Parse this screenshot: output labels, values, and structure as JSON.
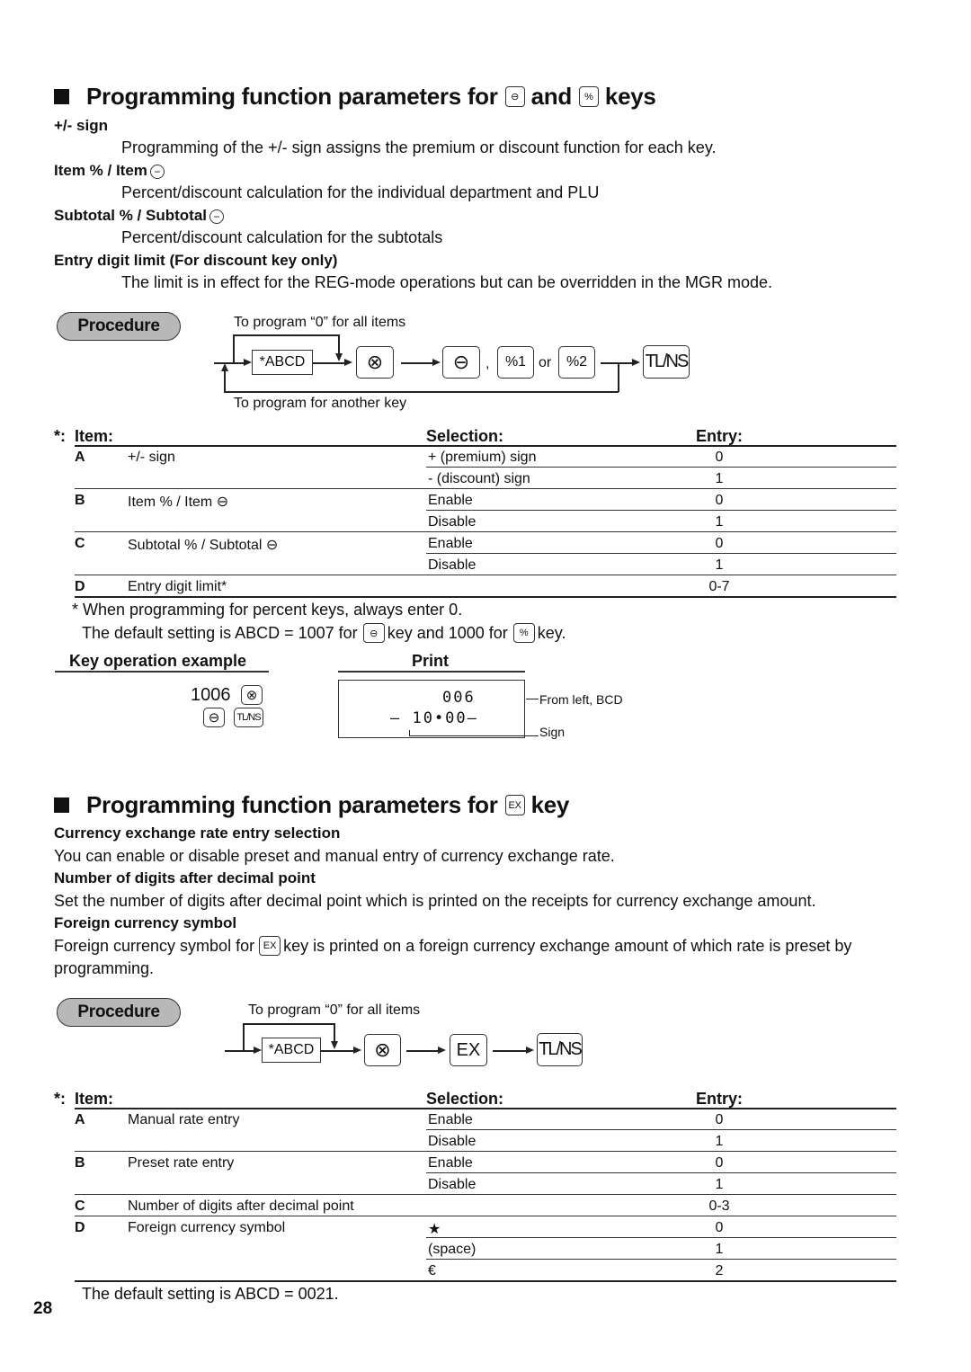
{
  "section1": {
    "heading_pre": "Programming function parameters for",
    "heading_key1": "⊖",
    "heading_mid": "and",
    "heading_key2": "%",
    "heading_post": "keys",
    "params": [
      {
        "title": "+/- sign",
        "desc": "Programming of the +/- sign assigns the premium or discount function for each key."
      },
      {
        "title": "Item % / Item",
        "desc": "Percent/discount calculation for the individual department and PLU"
      },
      {
        "title": "Subtotal % / Subtotal",
        "desc": "Percent/discount calculation for the subtotals"
      },
      {
        "title": "Entry digit limit (For discount key only)",
        "desc": "The limit is in effect for the REG-mode operations but can be overridden in the MGR mode."
      }
    ],
    "procedure": {
      "label": "Procedure",
      "loop_top": "To program “0” for all items",
      "loop_bottom": "To program for another key",
      "abcd": "*ABCD",
      "keys": {
        "multiply": "⊗",
        "minus": "⊖",
        "pct1": "%1",
        "or": "or",
        "pct2": "%2",
        "comma": ",",
        "tlns": "TL/NS"
      }
    },
    "table": {
      "star": "*:",
      "headers": {
        "item": "Item:",
        "selection": "Selection:",
        "entry": "Entry:"
      },
      "rows": [
        {
          "letter": "A",
          "item": "+/- sign",
          "selection": "+ (premium) sign",
          "entry": "0"
        },
        {
          "letter": "",
          "item": "",
          "selection": "- (discount) sign",
          "entry": "1"
        },
        {
          "letter": "B",
          "item": "Item % / Item ⊖",
          "selection": "Enable",
          "entry": "0"
        },
        {
          "letter": "",
          "item": "",
          "selection": "Disable",
          "entry": "1"
        },
        {
          "letter": "C",
          "item": "Subtotal % / Subtotal ⊖",
          "selection": "Enable",
          "entry": "0"
        },
        {
          "letter": "",
          "item": "",
          "selection": "Disable",
          "entry": "1"
        },
        {
          "letter": "D",
          "item": "Entry digit limit*",
          "selection": "",
          "entry": "0-7"
        }
      ]
    },
    "footnote": "* When programming for percent keys, always enter 0.",
    "default_pre": "The default setting is ABCD = 1007 for",
    "default_mid": "key and 1000 for",
    "default_post": "key.",
    "example": {
      "key_op_title": "Key operation example",
      "print_title": "Print",
      "entry_number": "1006",
      "print_line1": "006",
      "print_line2": "–  10•00–",
      "label_bcd": "From left, BCD",
      "label_sign": "Sign"
    }
  },
  "section2": {
    "heading_pre": "Programming function parameters for",
    "heading_key": "EX",
    "heading_post": "key",
    "params": [
      {
        "title": "Currency exchange rate entry selection",
        "desc": "You can enable or disable preset and manual entry of currency exchange rate."
      },
      {
        "title": "Number of digits after decimal point",
        "desc": "Set the number of digits after decimal point which is printed on the receipts for currency exchange amount."
      },
      {
        "title": "Foreign currency symbol",
        "desc_pre": "Foreign currency symbol for",
        "desc_post": "key is printed on a foreign currency exchange amount of which rate is preset by",
        "desc_line2": "programming."
      }
    ],
    "procedure": {
      "label": "Procedure",
      "loop_top": "To program “0” for all items",
      "abcd": "*ABCD",
      "keys": {
        "multiply": "⊗",
        "ex": "EX",
        "tlns": "TL/NS"
      }
    },
    "table": {
      "star": "*:",
      "headers": {
        "item": "Item:",
        "selection": "Selection:",
        "entry": "Entry:"
      },
      "rows": [
        {
          "letter": "A",
          "item": "Manual rate entry",
          "selection": "Enable",
          "entry": "0"
        },
        {
          "letter": "",
          "item": "",
          "selection": "Disable",
          "entry": "1"
        },
        {
          "letter": "B",
          "item": "Preset rate entry",
          "selection": "Enable",
          "entry": "0"
        },
        {
          "letter": "",
          "item": "",
          "selection": "Disable",
          "entry": "1"
        },
        {
          "letter": "C",
          "item": "Number of digits after decimal point",
          "selection": "",
          "entry": "0-3"
        },
        {
          "letter": "D",
          "item": "Foreign currency symbol",
          "selection": "★",
          "entry": "0"
        },
        {
          "letter": "",
          "item": "",
          "selection": "(space)",
          "entry": "1"
        },
        {
          "letter": "",
          "item": "",
          "selection": "€",
          "entry": "2"
        }
      ]
    },
    "default": "The default setting is ABCD = 0021."
  },
  "page_number": "28"
}
